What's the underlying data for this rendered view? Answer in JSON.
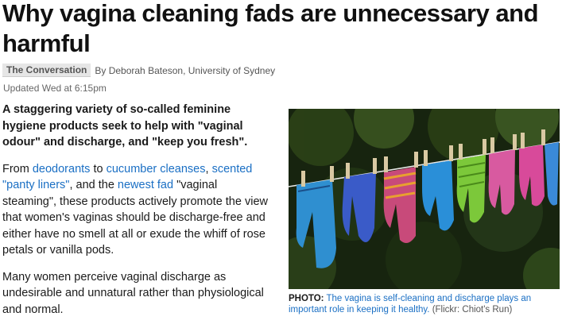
{
  "article": {
    "headline": "Why vagina cleaning fads are unnecessary and harmful",
    "source": "The Conversation",
    "author": "By Deborah Bateson, University of Sydney",
    "updated": "Updated Wed at 6:15pm",
    "lede": "A staggering variety of so-called feminine hygiene products seek to help with \"vaginal odour\" and discharge, and \"keep you fresh\".",
    "p1": {
      "t1": "From ",
      "link1": "deodorants",
      "t2": " to ",
      "link2": "cucumber cleanses",
      "t3": ", ",
      "link3": "scented \"panty liners\"",
      "t4": ", and the ",
      "link4": "newest fad",
      "t5": " \"vaginal steaming\", these products actively promote the view that women's vaginas should be discharge-free and either have no smell at all or exude the whiff of rose petals or vanilla pods."
    },
    "p2": "Many women perceive vaginal discharge as undesirable and unnatural rather than physiological and normal."
  },
  "photo": {
    "caption_label": "PHOTO:",
    "caption_text": "The vagina is self-cleaning and discharge plays an important role in keeping it healthy.",
    "caption_credit": "(Flickr: Chiot's Run)"
  },
  "colors": {
    "link": "#1a6fc4",
    "headline": "#111111",
    "meta": "#555555"
  }
}
